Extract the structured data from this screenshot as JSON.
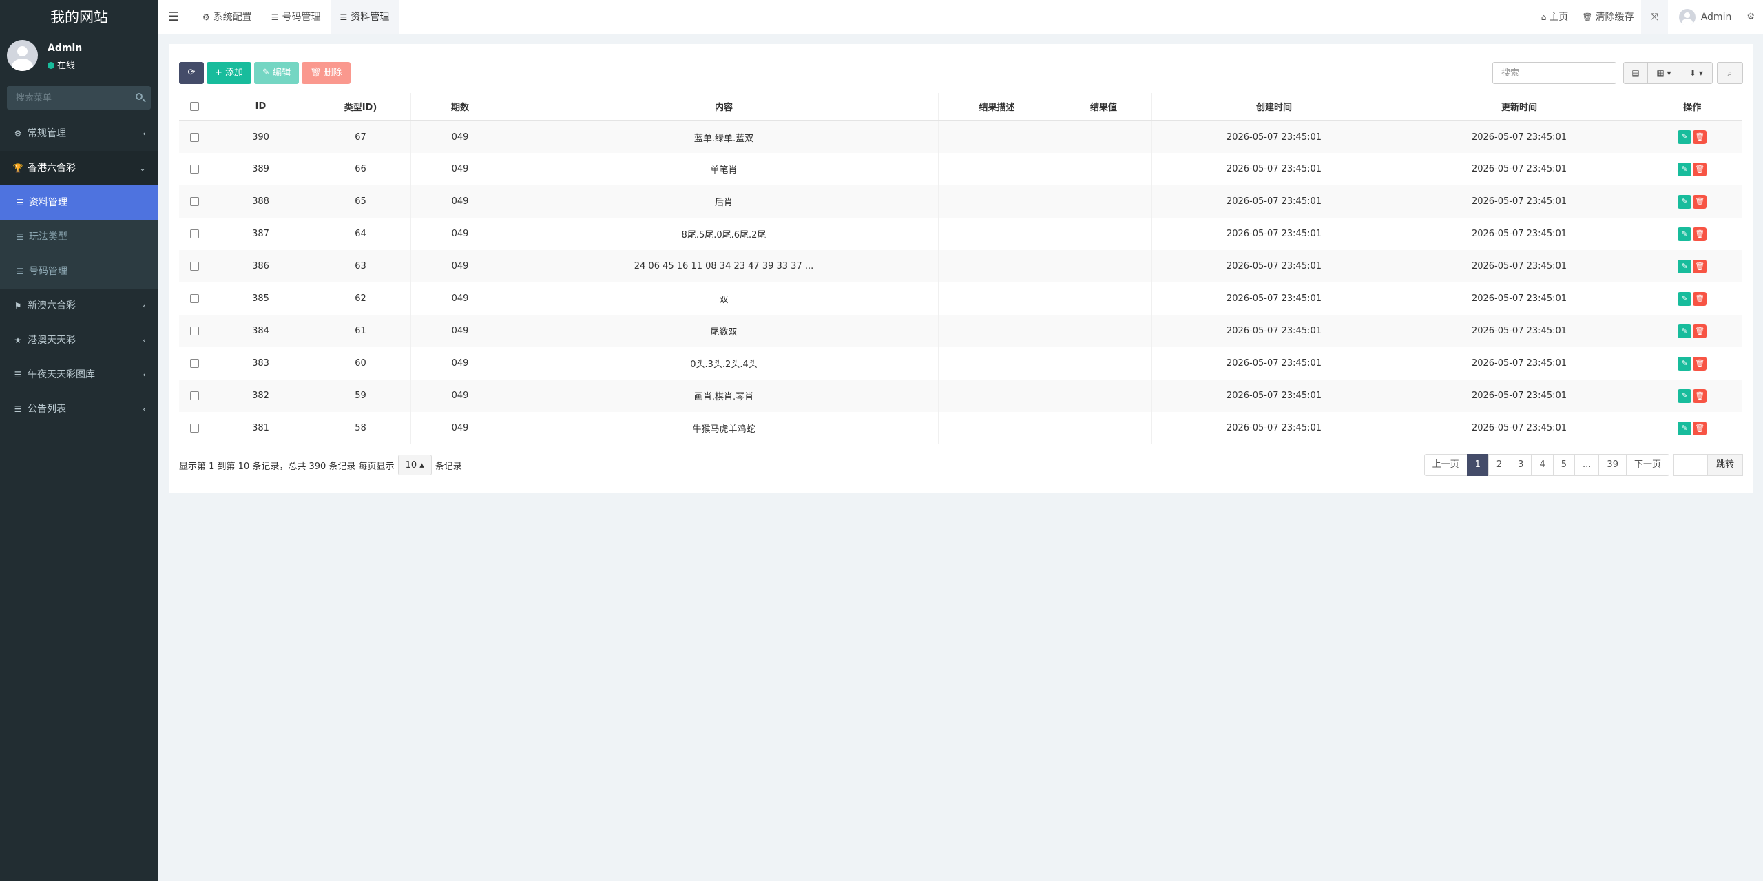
{
  "sidebar": {
    "logo": "我的网站",
    "user": {
      "name": "Admin",
      "status": "在线"
    },
    "search_placeholder": "搜索菜单",
    "menu": [
      {
        "label": "常规管理",
        "icon": "cogs-icon"
      },
      {
        "label": "香港六合彩",
        "icon": "trophy-icon"
      },
      {
        "label": "新澳六合彩",
        "icon": "flag-icon"
      },
      {
        "label": "港澳天天彩",
        "icon": "star-icon"
      },
      {
        "label": "午夜天天彩图库",
        "icon": "list-icon"
      },
      {
        "label": "公告列表",
        "icon": "list-icon"
      }
    ],
    "submenu": [
      {
        "label": "资料管理",
        "active": true
      },
      {
        "label": "玩法类型"
      },
      {
        "label": "号码管理"
      }
    ]
  },
  "topbar": {
    "tabs": [
      {
        "label": "系统配置",
        "icon": "gear-icon"
      },
      {
        "label": "号码管理",
        "icon": "list-icon"
      },
      {
        "label": "资料管理",
        "icon": "list-icon",
        "active": true
      }
    ],
    "home": "主页",
    "clear_cache": "清除缓存",
    "admin": "Admin"
  },
  "toolbar": {
    "add": "添加",
    "edit": "编辑",
    "delete": "删除",
    "search_placeholder": "搜索"
  },
  "table": {
    "headers": [
      "ID",
      "类型ID)",
      "期数",
      "内容",
      "结果描述",
      "结果值",
      "创建时间",
      "更新时间",
      "操作"
    ],
    "rows": [
      {
        "id": "390",
        "type_id": "67",
        "period": "049",
        "content": "蓝单.绿单.蓝双",
        "desc": "",
        "value": "",
        "created": "2026-05-07 23:45:01",
        "updated": "2026-05-07 23:45:01"
      },
      {
        "id": "389",
        "type_id": "66",
        "period": "049",
        "content": "单笔肖",
        "desc": "",
        "value": "",
        "created": "2026-05-07 23:45:01",
        "updated": "2026-05-07 23:45:01"
      },
      {
        "id": "388",
        "type_id": "65",
        "period": "049",
        "content": "后肖",
        "desc": "",
        "value": "",
        "created": "2026-05-07 23:45:01",
        "updated": "2026-05-07 23:45:01"
      },
      {
        "id": "387",
        "type_id": "64",
        "period": "049",
        "content": "8尾.5尾.0尾.6尾.2尾",
        "desc": "",
        "value": "",
        "created": "2026-05-07 23:45:01",
        "updated": "2026-05-07 23:45:01"
      },
      {
        "id": "386",
        "type_id": "63",
        "period": "049",
        "content": "24 06 45 16 11 08 34 23 47 39 33 37 ...",
        "desc": "",
        "value": "",
        "created": "2026-05-07 23:45:01",
        "updated": "2026-05-07 23:45:01"
      },
      {
        "id": "385",
        "type_id": "62",
        "period": "049",
        "content": "双",
        "desc": "",
        "value": "",
        "created": "2026-05-07 23:45:01",
        "updated": "2026-05-07 23:45:01"
      },
      {
        "id": "384",
        "type_id": "61",
        "period": "049",
        "content": "尾数双",
        "desc": "",
        "value": "",
        "created": "2026-05-07 23:45:01",
        "updated": "2026-05-07 23:45:01"
      },
      {
        "id": "383",
        "type_id": "60",
        "period": "049",
        "content": "0头.3头.2头.4头",
        "desc": "",
        "value": "",
        "created": "2026-05-07 23:45:01",
        "updated": "2026-05-07 23:45:01"
      },
      {
        "id": "382",
        "type_id": "59",
        "period": "049",
        "content": "画肖.棋肖.琴肖",
        "desc": "",
        "value": "",
        "created": "2026-05-07 23:45:01",
        "updated": "2026-05-07 23:45:01"
      },
      {
        "id": "381",
        "type_id": "58",
        "period": "049",
        "content": "牛猴马虎羊鸡蛇",
        "desc": "",
        "value": "",
        "created": "2026-05-07 23:45:01",
        "updated": "2026-05-07 23:45:01"
      }
    ]
  },
  "footer": {
    "info": "显示第 1 到第 10 条记录，总共 390 条记录 每页显示",
    "page_size": "10",
    "suffix": "条记录",
    "prev": "上一页",
    "pages": [
      "1",
      "2",
      "3",
      "4",
      "5",
      "...",
      "39"
    ],
    "next": "下一页",
    "jump": "跳转"
  },
  "colors": {
    "sidebar_bg": "#222d32",
    "active": "#4e73df",
    "success": "#18bc9c",
    "danger": "#f75444",
    "primary_dark": "#444c69"
  }
}
